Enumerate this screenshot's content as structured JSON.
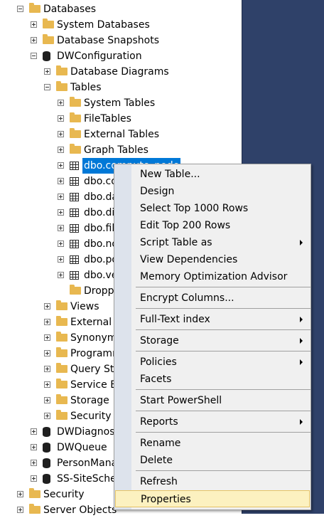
{
  "tree": {
    "rows": [
      {
        "label": "Databases",
        "level": 0,
        "expander": "minus",
        "icon": "folder"
      },
      {
        "label": "System Databases",
        "level": 1,
        "expander": "plus",
        "icon": "folder"
      },
      {
        "label": "Database Snapshots",
        "level": 1,
        "expander": "plus",
        "icon": "folder"
      },
      {
        "label": "DWConfiguration",
        "level": 1,
        "expander": "minus",
        "icon": "database"
      },
      {
        "label": "Database Diagrams",
        "level": 2,
        "expander": "plus",
        "icon": "folder"
      },
      {
        "label": "Tables",
        "level": 2,
        "expander": "minus",
        "icon": "folder"
      },
      {
        "label": "System Tables",
        "level": 3,
        "expander": "plus",
        "icon": "folder"
      },
      {
        "label": "FileTables",
        "level": 3,
        "expander": "plus",
        "icon": "folder"
      },
      {
        "label": "External Tables",
        "level": 3,
        "expander": "plus",
        "icon": "folder"
      },
      {
        "label": "Graph Tables",
        "level": 3,
        "expander": "plus",
        "icon": "folder"
      },
      {
        "label": "dbo.compute_node",
        "level": 3,
        "expander": "plus",
        "icon": "table",
        "selected": true
      },
      {
        "label": "dbo.co",
        "level": 3,
        "expander": "plus",
        "icon": "table"
      },
      {
        "label": "dbo.da",
        "level": 3,
        "expander": "plus",
        "icon": "table"
      },
      {
        "label": "dbo.di",
        "level": 3,
        "expander": "plus",
        "icon": "table"
      },
      {
        "label": "dbo.fil",
        "level": 3,
        "expander": "plus",
        "icon": "table"
      },
      {
        "label": "dbo.no",
        "level": 3,
        "expander": "plus",
        "icon": "table"
      },
      {
        "label": "dbo.pd",
        "level": 3,
        "expander": "plus",
        "icon": "table"
      },
      {
        "label": "dbo.ve",
        "level": 3,
        "expander": "plus",
        "icon": "table"
      },
      {
        "label": "Dropp",
        "level": 3,
        "expander": "none",
        "icon": "folder"
      },
      {
        "label": "Views",
        "level": 2,
        "expander": "plus",
        "icon": "folder"
      },
      {
        "label": "External R",
        "level": 2,
        "expander": "plus",
        "icon": "folder"
      },
      {
        "label": "Synonym",
        "level": 2,
        "expander": "plus",
        "icon": "folder"
      },
      {
        "label": "Programm",
        "level": 2,
        "expander": "plus",
        "icon": "folder"
      },
      {
        "label": "Query Sto",
        "level": 2,
        "expander": "plus",
        "icon": "folder"
      },
      {
        "label": "Service B",
        "level": 2,
        "expander": "plus",
        "icon": "folder"
      },
      {
        "label": "Storage",
        "level": 2,
        "expander": "plus",
        "icon": "folder"
      },
      {
        "label": "Security",
        "level": 2,
        "expander": "plus",
        "icon": "folder"
      },
      {
        "label": "DWDiagnos",
        "level": 1,
        "expander": "plus",
        "icon": "database"
      },
      {
        "label": "DWQueue",
        "level": 1,
        "expander": "plus",
        "icon": "database"
      },
      {
        "label": "PersonMana",
        "level": 1,
        "expander": "plus",
        "icon": "database"
      },
      {
        "label": "SS-SiteSche",
        "level": 1,
        "expander": "plus",
        "icon": "database"
      },
      {
        "label": "Security",
        "level": 0,
        "expander": "plus",
        "icon": "folder"
      },
      {
        "label": "Server Objects",
        "level": 0,
        "expander": "plus",
        "icon": "folder"
      }
    ]
  },
  "context_menu": {
    "items": [
      {
        "type": "item",
        "label": "New Table..."
      },
      {
        "type": "item",
        "label": "Design"
      },
      {
        "type": "item",
        "label": "Select Top 1000 Rows"
      },
      {
        "type": "item",
        "label": "Edit Top 200 Rows"
      },
      {
        "type": "item",
        "label": "Script Table as",
        "submenu": true
      },
      {
        "type": "item",
        "label": "View Dependencies"
      },
      {
        "type": "item",
        "label": "Memory Optimization Advisor"
      },
      {
        "type": "separator"
      },
      {
        "type": "item",
        "label": "Encrypt Columns..."
      },
      {
        "type": "separator"
      },
      {
        "type": "item",
        "label": "Full-Text index",
        "submenu": true
      },
      {
        "type": "separator"
      },
      {
        "type": "item",
        "label": "Storage",
        "submenu": true
      },
      {
        "type": "separator"
      },
      {
        "type": "item",
        "label": "Policies",
        "submenu": true
      },
      {
        "type": "item",
        "label": "Facets"
      },
      {
        "type": "separator"
      },
      {
        "type": "item",
        "label": "Start PowerShell"
      },
      {
        "type": "separator"
      },
      {
        "type": "item",
        "label": "Reports",
        "submenu": true
      },
      {
        "type": "separator"
      },
      {
        "type": "item",
        "label": "Rename"
      },
      {
        "type": "item",
        "label": "Delete"
      },
      {
        "type": "separator"
      },
      {
        "type": "item",
        "label": "Refresh"
      },
      {
        "type": "item",
        "label": "Properties",
        "highlighted": true
      }
    ]
  },
  "colors": {
    "selection": "#0078d7",
    "menu_highlight": "#fcf1c0",
    "right_panel": "#2f4169"
  }
}
